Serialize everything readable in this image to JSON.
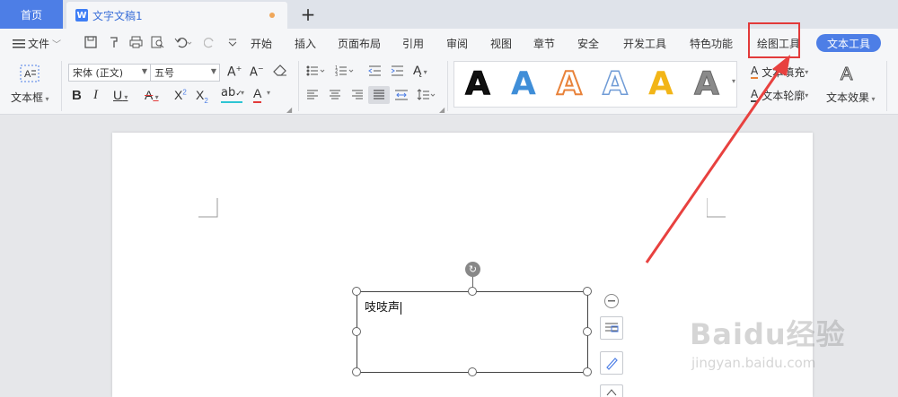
{
  "tabs": {
    "home": "首页",
    "document": "文字文稿1",
    "doc_icon": "W",
    "add": "+"
  },
  "menu": {
    "file": "文件",
    "items": [
      "开始",
      "插入",
      "页面布局",
      "引用",
      "审阅",
      "视图",
      "章节",
      "安全",
      "开发工具",
      "特色功能"
    ],
    "draw_tools": "绘图工具",
    "text_tools": "文本工具"
  },
  "ribbon": {
    "textbox_label": "文本框",
    "font_name": "宋体 (正文)",
    "font_size": "五号",
    "text_fill": "文本填充",
    "text_outline": "文本轮廓",
    "text_effect": "文本效果",
    "style_letter": "A",
    "style_colors": [
      "#111111",
      "#3f8ed8",
      "#e8823a",
      "#6f9bd6",
      "#f2b518",
      "#777777"
    ]
  },
  "document": {
    "textbox_content": "吱吱声"
  },
  "watermark": {
    "main": "Baidu经验",
    "sub": "jingyan.baidu.com"
  },
  "colors": {
    "accent": "#4d7ee6",
    "highlight_box": "#e23a3a",
    "arrow": "#e8413f"
  }
}
